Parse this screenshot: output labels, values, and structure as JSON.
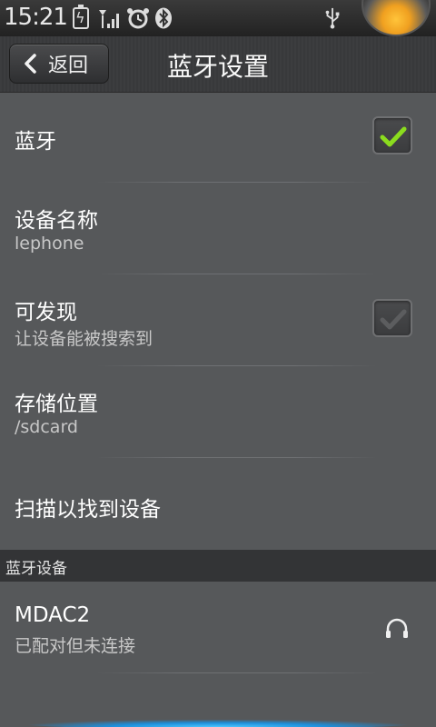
{
  "status_bar": {
    "time": "15:21"
  },
  "title_bar": {
    "back_label": "返回",
    "title": "蓝牙设置"
  },
  "settings": {
    "bluetooth": {
      "title": "蓝牙",
      "checked": true
    },
    "device_name": {
      "title": "设备名称",
      "value": "lephone"
    },
    "discoverable": {
      "title": "可发现",
      "subtitle": "让设备能被搜索到",
      "checked": false
    },
    "storage": {
      "title": "存储位置",
      "value": "/sdcard"
    },
    "scan": {
      "title": "扫描以找到设备"
    }
  },
  "devices_section": {
    "header": "蓝牙设备",
    "devices": [
      {
        "name": "MDAC2",
        "status": "已配对但未连接",
        "icon": "headphones-icon"
      }
    ]
  },
  "colors": {
    "background": "#56585a",
    "check_green": "#8bdc1e",
    "accent_blue": "#33b5ff"
  }
}
